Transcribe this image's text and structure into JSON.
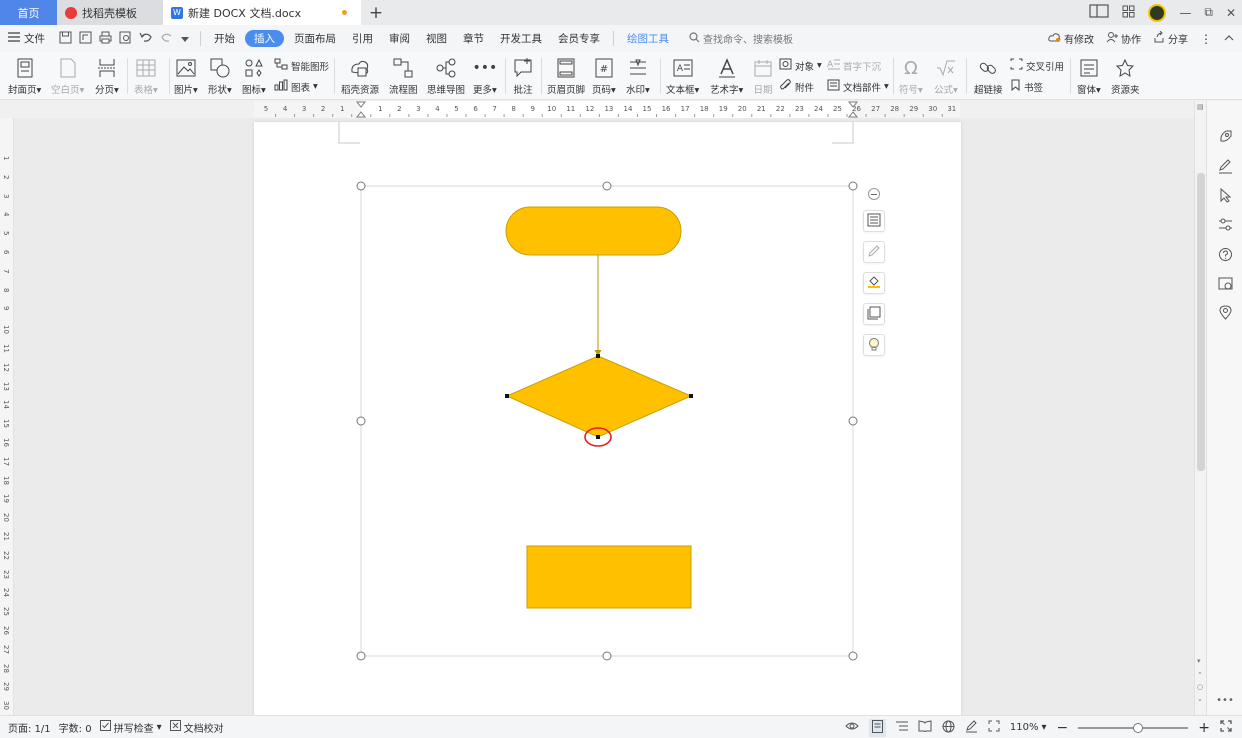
{
  "tabs": {
    "home": "首页",
    "template": "找稻壳模板",
    "document": "新建 DOCX 文档.docx",
    "new_tab": "+"
  },
  "window": {
    "layout_glyph": "1⃞",
    "grid_glyph": "⊞",
    "minimize": "—",
    "restore": "⧉",
    "close": "✕"
  },
  "menu": {
    "file": "文件",
    "items": [
      "开始",
      "插入",
      "页面布局",
      "引用",
      "审阅",
      "视图",
      "章节",
      "开发工具",
      "会员专享",
      "绘图工具"
    ],
    "active_index": 1,
    "search": "查找命令、搜索模板",
    "right": {
      "revisions": "有修改",
      "collab": "协作",
      "share": "分享"
    }
  },
  "ribbon": {
    "cover": "封面页",
    "blank": "空白页",
    "page_break": "分页",
    "table": "表格",
    "picture": "图片",
    "shape": "形状",
    "icon": "图标",
    "smart_art": "智能图形",
    "chart": "图表",
    "resources": "稻壳资源",
    "flowchart": "流程图",
    "mindmap": "思维导图",
    "more": "更多",
    "comment": "批注",
    "header_footer": "页眉页脚",
    "page_number": "页码",
    "watermark": "水印",
    "textbox": "文本框",
    "wordart": "艺术字",
    "date": "日期",
    "object": "对象",
    "attachment": "附件",
    "dropcap": "首字下沉",
    "doc_parts": "文档部件",
    "symbol": "符号",
    "formula": "公式",
    "hyperlink": "超链接",
    "cross_ref": "交叉引用",
    "bookmark": "书签",
    "window": "窗体",
    "library": "资源夹"
  },
  "ruler": {
    "h_numbers": [
      "5",
      "4",
      "3",
      "2",
      "1",
      "",
      "1",
      "2",
      "3",
      "4",
      "5",
      "6",
      "7",
      "8",
      "9",
      "10",
      "11",
      "12",
      "13",
      "14",
      "15",
      "16",
      "17",
      "18",
      "19",
      "20",
      "21",
      "22",
      "23",
      "24",
      "25",
      "26",
      "27",
      "28",
      "29",
      "30",
      "31"
    ],
    "v_numbers": [
      "1",
      "2",
      "3",
      "4",
      "5",
      "6",
      "7",
      "8",
      "9",
      "10",
      "11",
      "12",
      "13",
      "14",
      "15",
      "16",
      "17",
      "18",
      "19",
      "20",
      "21",
      "22",
      "23",
      "24",
      "25",
      "26",
      "27",
      "28",
      "29",
      "30"
    ]
  },
  "flowchart": {
    "fill": "#FFC000",
    "stroke": "#C8A000",
    "connector": "#B8960A",
    "highlight_ring": "#E02020"
  },
  "statusbar": {
    "page": "页面: 1/1",
    "words": "字数: 0",
    "spell": "拼写检查",
    "proofread": "文档校对",
    "zoom": "110%",
    "zoom_level": 0.55
  },
  "colors": {
    "accent": "#4A8CF0",
    "home_tab": "#4F86E8",
    "unsaved_dot": "#F59A23"
  }
}
